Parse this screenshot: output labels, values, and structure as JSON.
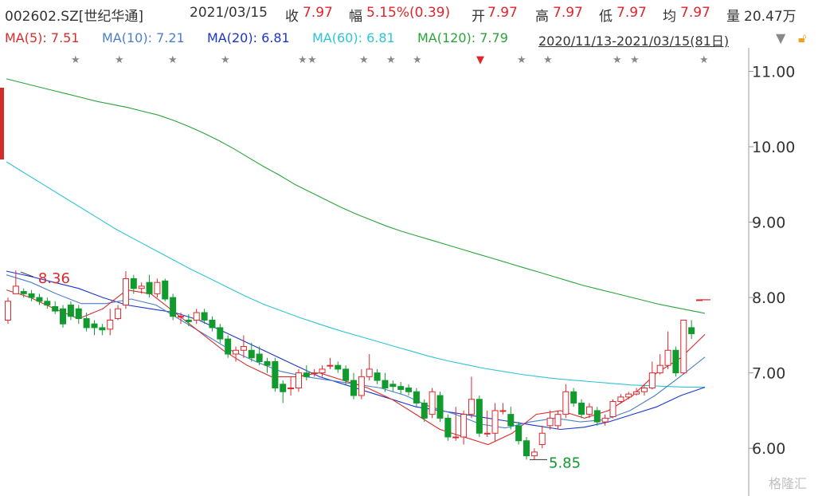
{
  "header": {
    "symbol": "002602.SZ[世纪华通]",
    "date": "2021/03/15",
    "close_label": "收",
    "close": "7.97",
    "change_label": "幅",
    "change": "5.15%(0.39)",
    "open_label": "开",
    "open": "7.97",
    "high_label": "高",
    "high": "7.97",
    "low_label": "低",
    "low": "7.97",
    "avg_label": "均",
    "avg": "7.97",
    "volume_label": "量",
    "volume": "20.47万"
  },
  "ma_legend": {
    "ma5": "MA(5): 7.51",
    "ma10": "MA(10): 7.21",
    "ma20": "MA(20): 6.81",
    "ma60": "MA(60): 6.81",
    "ma120": "MA(120): 7.79",
    "range": "2020/11/13-2021/03/15(81日)"
  },
  "colors": {
    "up": "#e0262b",
    "down": "#119a2e",
    "ma5": "#d92b2b",
    "ma10": "#4a7fc8",
    "ma20": "#1936c8",
    "ma60": "#2ec4d8",
    "ma120": "#2aa43a",
    "watermark": "#c0c0c0"
  },
  "watermark": "格隆汇",
  "chart_data": {
    "type": "candlestick",
    "ylim": [
      5.6,
      11.1
    ],
    "y_ticks": [
      "11.00",
      "10.00",
      "9.00",
      "8.00",
      "7.00",
      "6.00"
    ],
    "annotations": {
      "high": "8.36",
      "low": "5.85"
    },
    "candles": [
      [
        7.7,
        7.95,
        7.65,
        8.0
      ],
      [
        8.05,
        8.15,
        8.05,
        8.36
      ],
      [
        8.08,
        8.05,
        8.0,
        8.12
      ],
      [
        8.05,
        8.0,
        7.95,
        8.1
      ],
      [
        8.0,
        7.95,
        7.9,
        8.05
      ],
      [
        7.95,
        7.9,
        7.85,
        8.0
      ],
      [
        7.88,
        7.82,
        7.78,
        7.95
      ],
      [
        7.85,
        7.65,
        7.6,
        7.9
      ],
      [
        7.9,
        7.75,
        7.7,
        7.95
      ],
      [
        7.85,
        7.72,
        7.65,
        7.9
      ],
      [
        7.72,
        7.6,
        7.55,
        7.8
      ],
      [
        7.65,
        7.6,
        7.5,
        7.7
      ],
      [
        7.6,
        7.57,
        7.5,
        7.65
      ],
      [
        7.58,
        7.7,
        7.5,
        7.85
      ],
      [
        7.72,
        7.85,
        7.7,
        7.9
      ],
      [
        7.9,
        8.25,
        7.85,
        8.35
      ],
      [
        8.25,
        8.12,
        8.05,
        8.3
      ],
      [
        8.12,
        8.15,
        8.05,
        8.2
      ],
      [
        8.2,
        8.05,
        8.0,
        8.3
      ],
      [
        8.05,
        8.2,
        8.0,
        8.25
      ],
      [
        8.22,
        7.98,
        7.95,
        8.25
      ],
      [
        8.0,
        7.75,
        7.7,
        8.05
      ],
      [
        7.75,
        7.75,
        7.65,
        7.8
      ],
      [
        7.7,
        7.68,
        7.62,
        7.78
      ],
      [
        7.7,
        7.8,
        7.65,
        7.85
      ],
      [
        7.8,
        7.7,
        7.65,
        7.85
      ],
      [
        7.7,
        7.6,
        7.55,
        7.75
      ],
      [
        7.6,
        7.45,
        7.4,
        7.65
      ],
      [
        7.45,
        7.25,
        7.2,
        7.5
      ],
      [
        7.25,
        7.3,
        7.15,
        7.35
      ],
      [
        7.3,
        7.35,
        7.2,
        7.5
      ],
      [
        7.3,
        7.2,
        7.15,
        7.4
      ],
      [
        7.25,
        7.15,
        7.1,
        7.35
      ],
      [
        7.15,
        7.1,
        7.0,
        7.2
      ],
      [
        7.15,
        6.8,
        6.75,
        7.2
      ],
      [
        6.85,
        6.75,
        6.6,
        6.9
      ],
      [
        6.8,
        6.8,
        6.7,
        6.95
      ],
      [
        6.8,
        7.0,
        6.75,
        7.05
      ],
      [
        7.0,
        6.95,
        6.9,
        7.1
      ],
      [
        7.0,
        7.0,
        6.95,
        7.05
      ],
      [
        7.0,
        7.05,
        6.95,
        7.1
      ],
      [
        7.1,
        7.1,
        7.05,
        7.2
      ],
      [
        7.1,
        7.05,
        7.0,
        7.15
      ],
      [
        7.05,
        6.9,
        6.85,
        7.1
      ],
      [
        6.9,
        6.7,
        6.65,
        7.0
      ],
      [
        6.7,
        6.95,
        6.65,
        7.05
      ],
      [
        6.95,
        7.05,
        6.9,
        7.25
      ],
      [
        7.0,
        6.9,
        6.85,
        7.05
      ],
      [
        6.9,
        6.8,
        6.75,
        7.0
      ],
      [
        6.85,
        6.82,
        6.75,
        6.9
      ],
      [
        6.82,
        6.78,
        6.72,
        6.88
      ],
      [
        6.8,
        6.75,
        6.7,
        6.85
      ],
      [
        6.75,
        6.6,
        6.55,
        6.8
      ],
      [
        6.6,
        6.4,
        6.35,
        6.65
      ],
      [
        6.45,
        6.75,
        6.4,
        6.8
      ],
      [
        6.7,
        6.4,
        6.35,
        6.75
      ],
      [
        6.4,
        6.15,
        6.1,
        6.45
      ],
      [
        6.15,
        6.15,
        6.1,
        6.55
      ],
      [
        6.15,
        6.45,
        6.05,
        6.5
      ],
      [
        6.45,
        6.65,
        6.4,
        6.95
      ],
      [
        6.65,
        6.2,
        6.15,
        6.7
      ],
      [
        6.2,
        6.2,
        6.15,
        6.5
      ],
      [
        6.2,
        6.5,
        6.1,
        6.6
      ],
      [
        6.5,
        6.5,
        6.45,
        6.6
      ],
      [
        6.45,
        6.3,
        6.25,
        6.55
      ],
      [
        6.3,
        6.1,
        6.05,
        6.35
      ],
      [
        6.1,
        5.9,
        5.85,
        6.15
      ],
      [
        5.9,
        5.95,
        5.85,
        6.0
      ],
      [
        6.05,
        6.2,
        6.0,
        6.3
      ],
      [
        6.3,
        6.4,
        6.25,
        6.5
      ],
      [
        6.3,
        6.45,
        6.25,
        6.5
      ],
      [
        6.45,
        6.75,
        6.4,
        6.85
      ],
      [
        6.75,
        6.6,
        6.55,
        6.8
      ],
      [
        6.6,
        6.45,
        6.4,
        6.65
      ],
      [
        6.45,
        6.55,
        6.4,
        6.6
      ],
      [
        6.5,
        6.35,
        6.3,
        6.55
      ],
      [
        6.35,
        6.4,
        6.3,
        6.45
      ],
      [
        6.42,
        6.62,
        6.4,
        6.65
      ],
      [
        6.62,
        6.68,
        6.6,
        6.72
      ],
      [
        6.68,
        6.72,
        6.65,
        6.75
      ],
      [
        6.72,
        6.75,
        6.7,
        6.8
      ]
    ],
    "extra_candles": [
      [
        6.75,
        6.8,
        6.7,
        6.85
      ],
      [
        6.8,
        7.0,
        6.78,
        7.15
      ],
      [
        7.0,
        7.1,
        6.98,
        7.25
      ],
      [
        7.1,
        7.3,
        7.05,
        7.55
      ],
      [
        7.3,
        7.0,
        6.95,
        7.35
      ],
      [
        7.0,
        7.7,
        6.98,
        7.7
      ],
      [
        7.6,
        7.52,
        7.45,
        7.7
      ],
      [
        7.97,
        7.97,
        7.97,
        7.97
      ]
    ],
    "ma120": [
      10.9,
      10.85,
      10.8,
      10.75,
      10.7,
      10.65,
      10.6,
      10.56,
      10.52,
      10.47,
      10.42,
      10.35,
      10.27,
      10.18,
      10.08,
      9.97,
      9.85,
      9.73,
      9.62,
      9.5,
      9.4,
      9.3,
      9.2,
      9.11,
      9.03,
      8.95,
      8.88,
      8.82,
      8.76,
      8.7,
      8.64,
      8.58,
      8.52,
      8.46,
      8.4,
      8.34,
      8.28,
      8.22,
      8.16,
      8.11,
      8.06,
      8.01,
      7.96,
      7.91,
      7.87,
      7.83,
      7.79
    ],
    "ma60": [
      9.8,
      9.65,
      9.5,
      9.35,
      9.2,
      9.05,
      8.9,
      8.77,
      8.64,
      8.51,
      8.38,
      8.26,
      8.14,
      8.02,
      7.91,
      7.82,
      7.73,
      7.65,
      7.57,
      7.5,
      7.43,
      7.36,
      7.29,
      7.22,
      7.16,
      7.11,
      7.06,
      7.02,
      6.98,
      6.95,
      6.92,
      6.9,
      6.88,
      6.86,
      6.84,
      6.83,
      6.82,
      6.81,
      6.81
    ],
    "ma20": [
      8.35,
      8.28,
      8.2,
      8.12,
      8.0,
      7.9,
      7.85,
      7.8,
      7.7,
      7.55,
      7.4,
      7.25,
      7.1,
      6.95,
      6.85,
      6.75,
      6.65,
      6.55,
      6.5,
      6.45,
      6.4,
      6.35,
      6.3,
      6.25,
      6.28,
      6.35,
      6.45,
      6.55,
      6.7,
      6.81
    ],
    "ma10": [
      8.3,
      8.2,
      8.05,
      7.92,
      7.92,
      7.98,
      7.9,
      7.7,
      7.5,
      7.3,
      7.15,
      7.02,
      6.95,
      6.9,
      6.85,
      6.8,
      6.7,
      6.55,
      6.45,
      6.32,
      6.27,
      6.35,
      6.4,
      6.35,
      6.38,
      6.5,
      6.7,
      6.95,
      7.21
    ],
    "ma5": [
      8.1,
      8.0,
      7.85,
      7.72,
      7.85,
      8.1,
      8.05,
      7.8,
      7.55,
      7.3,
      7.1,
      6.95,
      6.95,
      7.0,
      6.9,
      6.8,
      6.65,
      6.45,
      6.25,
      6.15,
      6.05,
      6.2,
      6.45,
      6.5,
      6.4,
      6.5,
      6.7,
      7.0,
      7.2,
      7.51
    ],
    "markers": {
      "star": "★",
      "flag": "▼"
    }
  }
}
